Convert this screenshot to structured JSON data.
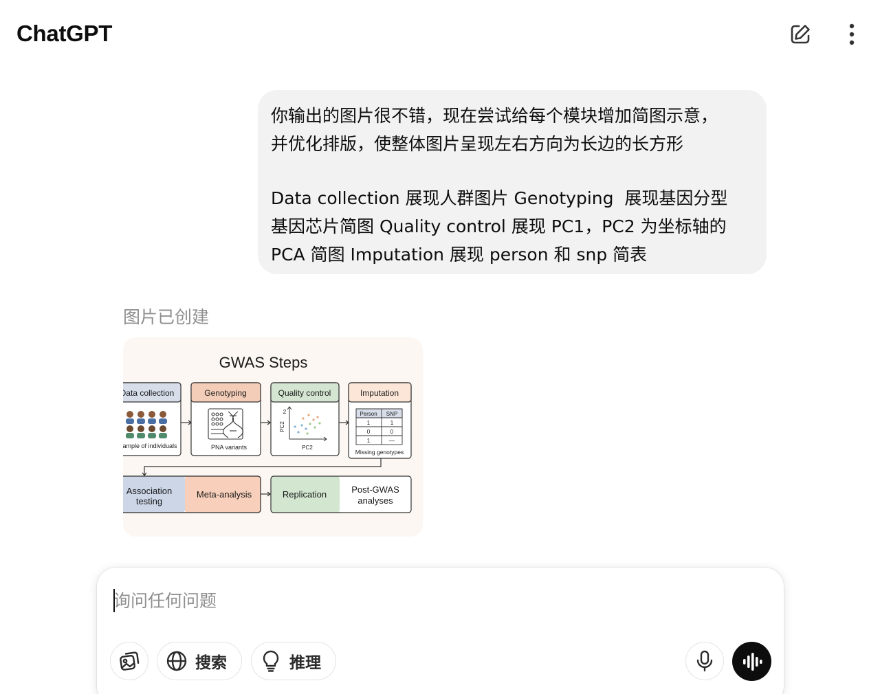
{
  "header": {
    "title": "ChatGPT",
    "new_chat_icon": "edit-icon",
    "menu_icon": "more-vertical-icon"
  },
  "conversation": {
    "user_message": {
      "paragraph_1": "你输出的图片很不错，现在尝试给每个模块增加简图示意，\n并优化排版，使整体图片呈现左右方向为长边的长方形",
      "paragraph_2": "Data collection 展现人群图片 Genotyping  展现基因分型\n基因芯片简图 Quality control 展现 PC1，PC2 为坐标轴的\nPCA 简图 Imputation 展现 person 和 snp 简表"
    },
    "assistant_status": "图片已创建",
    "image": {
      "title": "GWAS Steps",
      "modules": {
        "data_collection": {
          "header": "Data collection",
          "caption": "Sample of individuals"
        },
        "genotyping": {
          "header": "Genotyping",
          "caption": "PNA variants"
        },
        "quality_control": {
          "header": "Quality control",
          "y_axis": "PC2",
          "x_axis": "PC2",
          "y_tick": "2"
        },
        "imputation": {
          "header": "Imputation",
          "table_headers": [
            "Person",
            "SNP"
          ],
          "table_rows": [
            [
              "1",
              "1"
            ],
            [
              "0",
              "0"
            ],
            [
              "1",
              "—"
            ]
          ],
          "caption": "Missing genotypes"
        }
      },
      "bottom_steps": {
        "association_1": "Association",
        "association_2": "testing",
        "meta": "Meta-analysis",
        "replication": "Replication",
        "post_1": "Post-GWAS",
        "post_2": "analyses"
      },
      "colors": {
        "background": "#fcf7f2",
        "data_header": "#d7deea",
        "genotyping_header": "#f4cdb8",
        "qc_header": "#d4e6d1",
        "imputation_header": "#fbe6d8",
        "association_fill": "#ccd6e7",
        "meta_fill": "#f7cfba",
        "replication_fill": "#d2e6d0"
      }
    }
  },
  "composer": {
    "placeholder": "询问任何问题",
    "attach_icon": "image-attach-icon",
    "search_label": "搜索",
    "search_icon": "globe-icon",
    "reason_label": "推理",
    "reason_icon": "lightbulb-icon",
    "mic_icon": "microphone-icon",
    "voice_icon": "voice-waveform-icon"
  }
}
